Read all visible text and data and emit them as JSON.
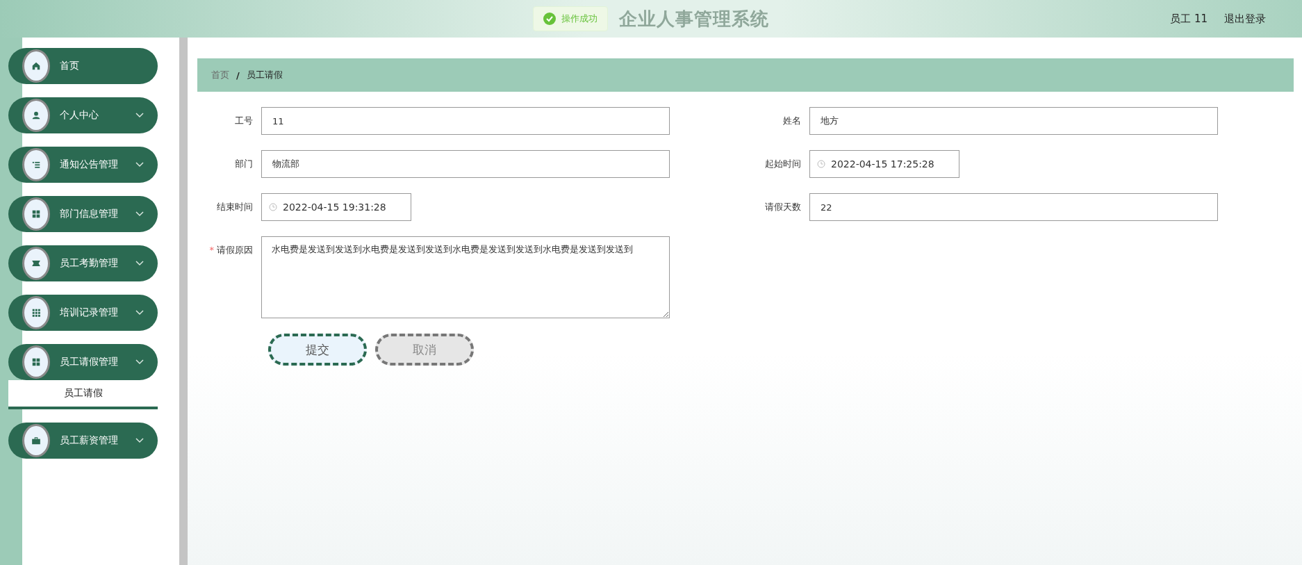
{
  "header": {
    "title": "企业人事管理系统",
    "toast": "操作成功",
    "user": "员工 11",
    "logout": "退出登录"
  },
  "sidebar": {
    "items": [
      {
        "label": "首页",
        "kind": "home",
        "expandable": false
      },
      {
        "label": "个人中心",
        "kind": "user",
        "expandable": true,
        "expanded": false
      },
      {
        "label": "通知公告管理",
        "kind": "list",
        "expandable": true,
        "expanded": false
      },
      {
        "label": "部门信息管理",
        "kind": "grid",
        "expandable": true,
        "expanded": false
      },
      {
        "label": "员工考勤管理",
        "kind": "ticket",
        "expandable": true,
        "expanded": false
      },
      {
        "label": "培训记录管理",
        "kind": "apps",
        "expandable": true,
        "expanded": false
      },
      {
        "label": "员工请假管理",
        "kind": "grid",
        "expandable": true,
        "expanded": true,
        "children": [
          {
            "label": "员工请假",
            "selected": true
          }
        ]
      },
      {
        "label": "员工薪资管理",
        "kind": "briefcase",
        "expandable": true,
        "expanded": false
      }
    ]
  },
  "breadcrumb": {
    "separator": "/",
    "items": [
      "首页",
      "员工请假"
    ]
  },
  "form": {
    "required_mark": "*",
    "fields": [
      {
        "label": "工号",
        "kind": "text",
        "value": "11",
        "required": false
      },
      {
        "label": "姓名",
        "kind": "text",
        "value": "地方",
        "required": false
      },
      {
        "label": "部门",
        "kind": "text",
        "value": "物流部",
        "required": false
      },
      {
        "label": "起始时间",
        "kind": "date",
        "value": "2022-04-15 17:25:28",
        "required": false
      },
      {
        "label": "结束时间",
        "kind": "date",
        "value": "2022-04-15 19:31:28",
        "required": false
      },
      {
        "label": "请假天数",
        "kind": "text",
        "value": "22",
        "required": false
      },
      {
        "label": "请假原因",
        "kind": "textarea",
        "value": "水电费是发送到发送到水电费是发送到发送到水电费是发送到发送到水电费是发送到发送到",
        "required": true
      }
    ],
    "buttons": [
      {
        "label": "提交",
        "kind": "primary"
      },
      {
        "label": "取消",
        "kind": "cancel"
      }
    ]
  }
}
